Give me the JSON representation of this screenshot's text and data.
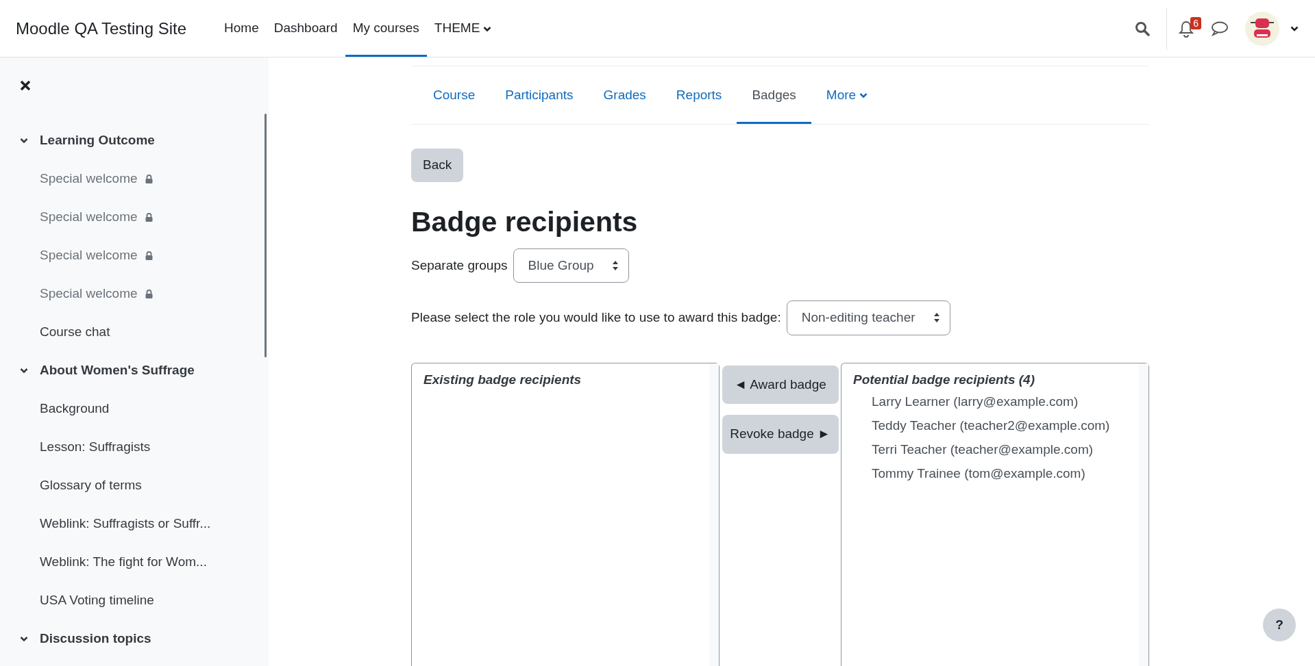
{
  "site_name": "Moodle QA Testing Site",
  "nav": [
    {
      "label": "Home",
      "selected": false,
      "has_menu": false
    },
    {
      "label": "Dashboard",
      "selected": false,
      "has_menu": false
    },
    {
      "label": "My courses",
      "selected": true,
      "has_menu": false
    },
    {
      "label": "THEME",
      "selected": false,
      "has_menu": true
    }
  ],
  "notifications": {
    "count": "6"
  },
  "sidebar": {
    "sections": [
      {
        "title": "Learning Outcome",
        "expanded": true,
        "children": [
          {
            "label": "Special welcome",
            "locked": true
          },
          {
            "label": "Special welcome",
            "locked": true
          },
          {
            "label": "Special welcome",
            "locked": true
          },
          {
            "label": "Special welcome",
            "locked": true
          },
          {
            "label": "Course chat",
            "locked": false
          }
        ]
      },
      {
        "title": "About Women's Suffrage",
        "expanded": true,
        "children": [
          {
            "label": "Background",
            "locked": false
          },
          {
            "label": "Lesson: Suffragists",
            "locked": false
          },
          {
            "label": "Glossary of terms",
            "locked": false
          },
          {
            "label": "Weblink: Suffragists or Suffr...",
            "locked": false
          },
          {
            "label": "Weblink: The fight for Wom...",
            "locked": false
          },
          {
            "label": "USA Voting timeline",
            "locked": false
          }
        ]
      },
      {
        "title": "Discussion topics",
        "expanded": true
      }
    ]
  },
  "course_tabs": [
    {
      "label": "Course",
      "selected": false,
      "has_menu": false
    },
    {
      "label": "Participants",
      "selected": false,
      "has_menu": false
    },
    {
      "label": "Grades",
      "selected": false,
      "has_menu": false
    },
    {
      "label": "Reports",
      "selected": false,
      "has_menu": false
    },
    {
      "label": "Badges",
      "selected": true,
      "has_menu": false
    },
    {
      "label": "More",
      "selected": false,
      "has_menu": true
    }
  ],
  "back_button": "Back",
  "heading": "Badge recipients",
  "group_select": {
    "label": "Separate groups",
    "value": "Blue Group"
  },
  "role_select": {
    "label": "Please select the role you would like to use to award this badge:",
    "value": "Non-editing teacher"
  },
  "existing": {
    "title": "Existing badge recipients"
  },
  "award_button": "◄ Award badge",
  "revoke_button": "Revoke badge ►",
  "potential": {
    "title": "Potential badge recipients (4)",
    "items": [
      "Larry Learner (larry@example.com)",
      "Teddy Teacher (teacher2@example.com)",
      "Terri Teacher (teacher@example.com)",
      "Tommy Trainee (tom@example.com)"
    ]
  },
  "help_button": "?"
}
